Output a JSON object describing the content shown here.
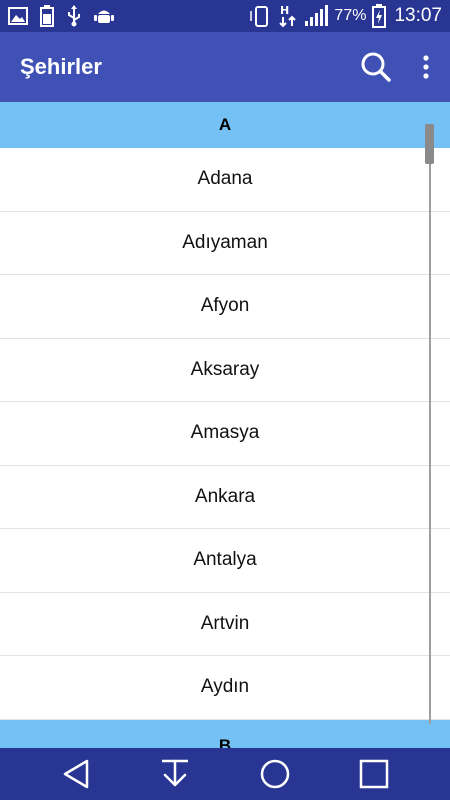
{
  "status_bar": {
    "battery": "77%",
    "time": "13:07",
    "icons": [
      "gallery-icon",
      "battery-saver-icon",
      "usb-icon",
      "android-debug-icon",
      "phone-rotate-icon",
      "hplus-data-icon",
      "signal-icon",
      "battery-charging-icon"
    ]
  },
  "app_bar": {
    "title": "Şehirler",
    "actions": [
      "search-icon",
      "more-vert-icon"
    ]
  },
  "sections": [
    {
      "letter": "A",
      "cities": [
        "Adana",
        "Adıyaman",
        "Afyon",
        "Aksaray",
        "Amasya",
        "Ankara",
        "Antalya",
        "Artvin",
        "Aydın"
      ]
    },
    {
      "letter": "B",
      "cities": []
    }
  ],
  "navigation": [
    "back-icon",
    "download-icon",
    "home-icon",
    "recents-icon"
  ],
  "colors": {
    "status_bar": "#283593",
    "app_bar": "#3f51b5",
    "section_header": "#74c2f5",
    "nav_bar": "#283593"
  }
}
